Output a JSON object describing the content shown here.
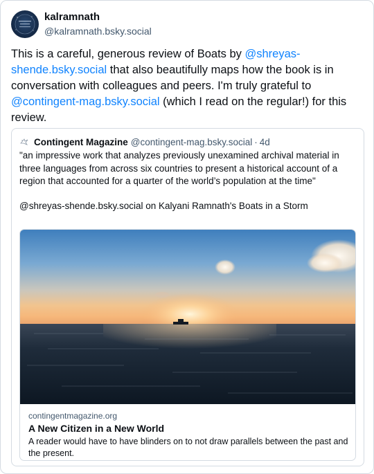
{
  "post": {
    "author": {
      "display_name": "kalramnath",
      "handle": "@kalramnath.bsky.social"
    },
    "text_segments": [
      "This is a careful, generous review of Boats by ",
      "@shreyas-shende.bsky.social",
      " that also beautifully maps how the book is in conversation with colleagues and peers. I'm truly grateful to ",
      "@contingent-mag.bsky.social",
      " (which I read on the regular!) for this review."
    ],
    "mention_color": "#1083fe"
  },
  "quote": {
    "author_name": "Contingent Magazine",
    "author_handle": "@contingent-mag.bsky.social",
    "separator": "·",
    "time": "4d",
    "paragraphs": [
      "\"an impressive work that analyzes previously unexamined archival material in three languages from across six countries to present a historical account of a region that accounted for a quarter of the world’s population at the time\"",
      "@shreyas-shende.bsky.social on Kalyani Ramnath's Boats in a Storm"
    ],
    "link_card": {
      "image_icon": "sea-sunset-image",
      "domain": "contingentmagazine.org",
      "title": "A New Citizen in a New World",
      "description": "A reader would have to have blinders on to not draw parallels between the past and the present."
    }
  }
}
